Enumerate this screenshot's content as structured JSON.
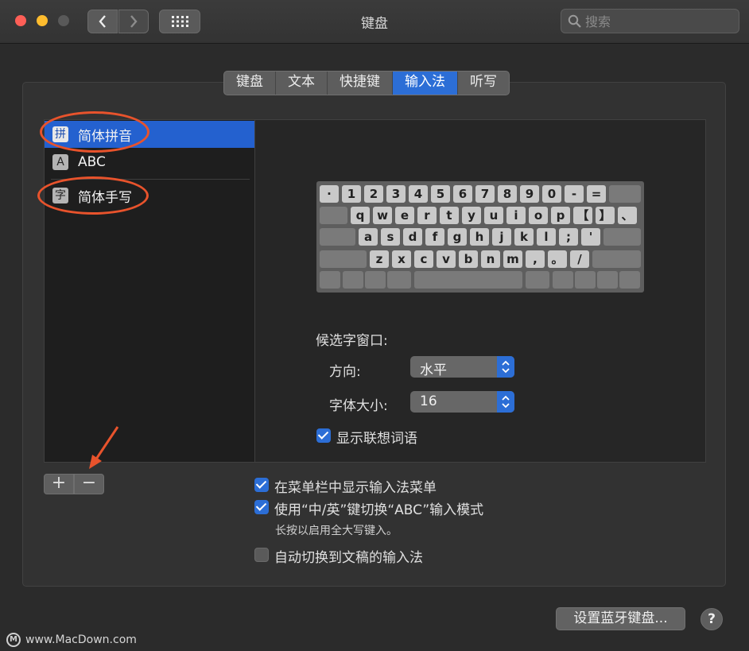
{
  "window": {
    "title": "键盘"
  },
  "search": {
    "placeholder": "搜索"
  },
  "tabs": [
    {
      "label": "键盘"
    },
    {
      "label": "文本"
    },
    {
      "label": "快捷键"
    },
    {
      "label": "输入法",
      "active": true
    },
    {
      "label": "听写"
    }
  ],
  "input_methods": [
    {
      "icon_char": "拼",
      "label": "简体拼音",
      "selected": true
    },
    {
      "icon_char": "A",
      "label": "ABC"
    },
    {
      "icon_char": "字",
      "label": "简体手写"
    }
  ],
  "keyboard": {
    "row1": [
      "·",
      "1",
      "2",
      "3",
      "4",
      "5",
      "6",
      "7",
      "8",
      "9",
      "0",
      "-",
      "="
    ],
    "row2": [
      "q",
      "w",
      "e",
      "r",
      "t",
      "y",
      "u",
      "i",
      "o",
      "p",
      "【",
      "】",
      "、"
    ],
    "row3": [
      "a",
      "s",
      "d",
      "f",
      "g",
      "h",
      "j",
      "k",
      "l",
      ";",
      "'"
    ],
    "row4": [
      "z",
      "x",
      "c",
      "v",
      "b",
      "n",
      "m",
      ",",
      "。",
      "/"
    ]
  },
  "candidate": {
    "heading": "候选字窗口:",
    "direction_label": "方向:",
    "direction_value": "水平",
    "font_size_label": "字体大小:",
    "font_size_value": "16",
    "show_assoc_label": "显示联想词语",
    "show_assoc_checked": true
  },
  "options": {
    "menu_label": "在菜单栏中显示输入法菜单",
    "menu_checked": true,
    "switch_label": "使用“中/英”键切换“ABC”输入模式",
    "switch_checked": true,
    "switch_hint": "长按以启用全大写键入。",
    "auto_label": "自动切换到文稿的输入法",
    "auto_checked": false
  },
  "list_buttons": {
    "add": "+",
    "remove": "−"
  },
  "footer": {
    "bluetooth_button": "设置蓝牙键盘...",
    "help": "?"
  },
  "watermark": {
    "mark": "M",
    "text": "www.MacDown.com"
  },
  "colors": {
    "accent": "#2c6ed6",
    "annotation": "#e8532c"
  }
}
